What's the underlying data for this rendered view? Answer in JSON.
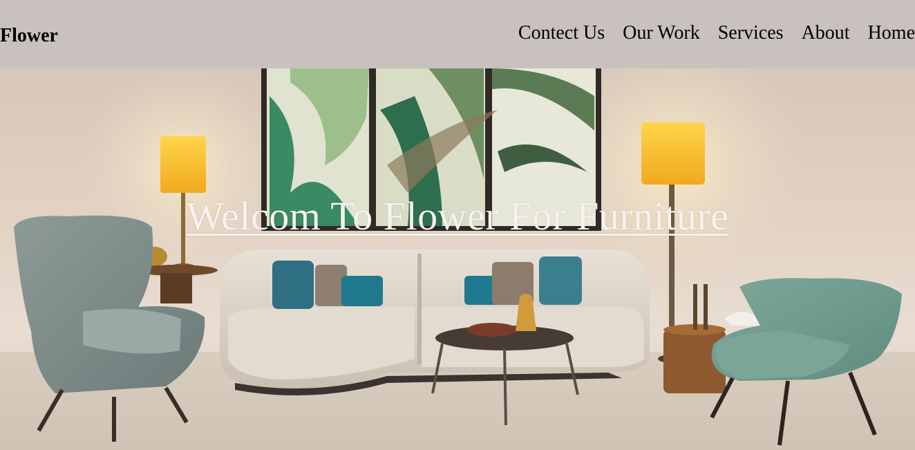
{
  "header": {
    "brand": "Flower",
    "nav": [
      {
        "label": "Contect Us"
      },
      {
        "label": "Our Work"
      },
      {
        "label": "Services"
      },
      {
        "label": "About"
      },
      {
        "label": "Home"
      }
    ]
  },
  "hero": {
    "title": "Welcom To Flower For Furniture",
    "image_alt": "living-room-furniture-photo"
  },
  "colors": {
    "header_bg": "#c9c1bd",
    "title_text": "#f7f2ee",
    "nav_text": "#000000"
  }
}
